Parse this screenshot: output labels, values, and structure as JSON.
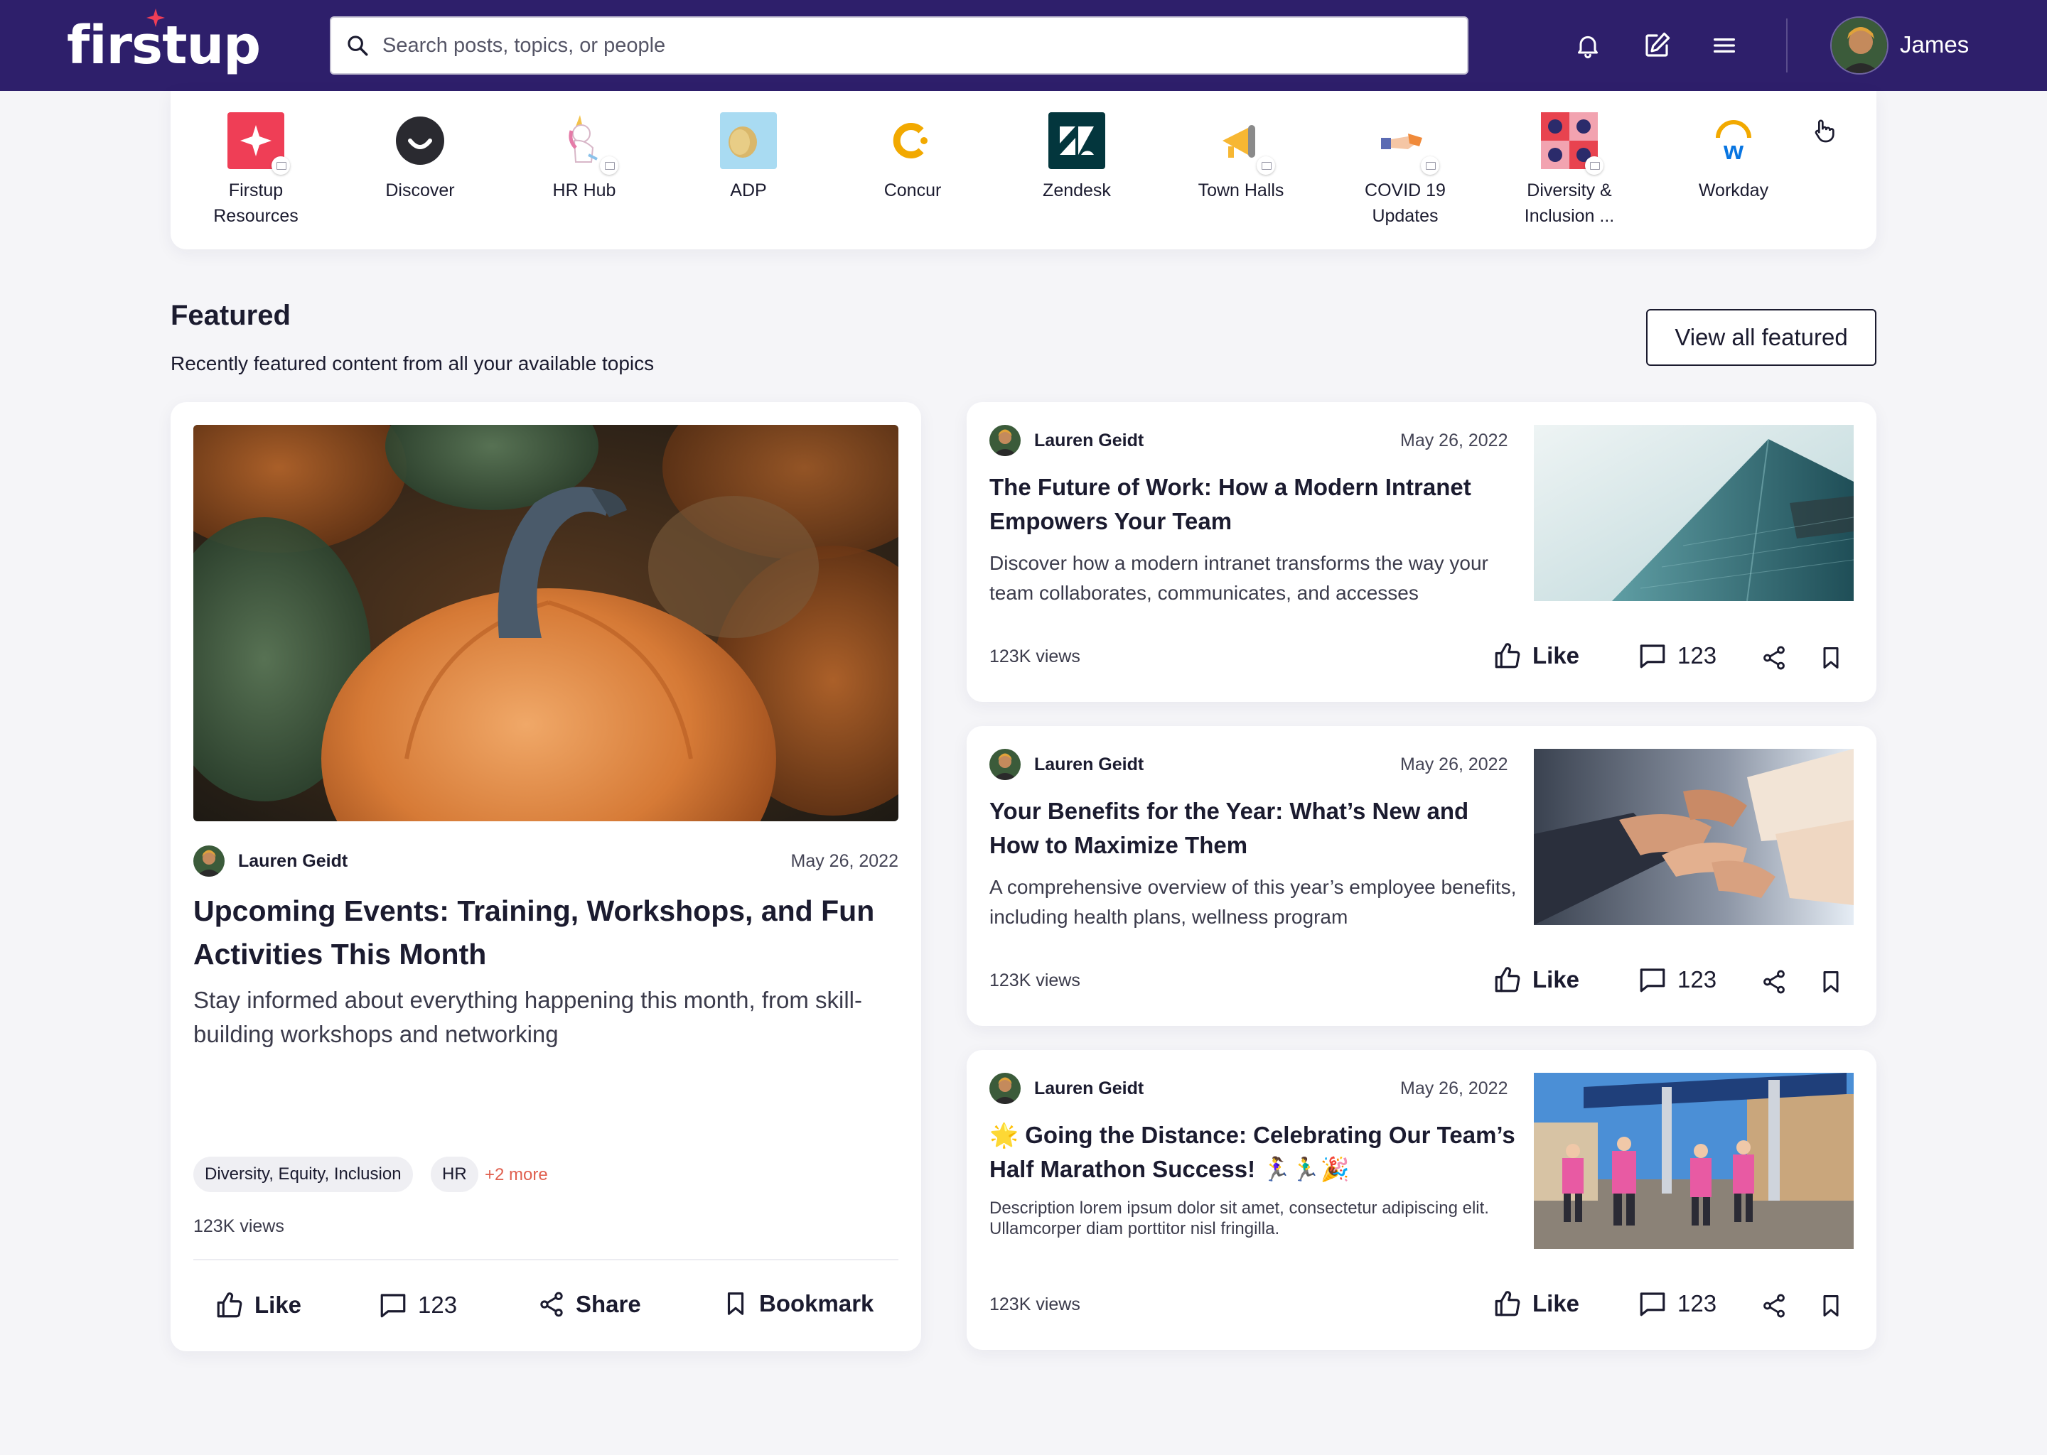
{
  "header": {
    "logo": "firstup",
    "search_placeholder": "Search posts, topics, or people",
    "user_name": "James"
  },
  "shortcuts": [
    {
      "label": "Firstup Resources",
      "icon": "firstup-star-icon"
    },
    {
      "label": "Discover",
      "icon": "smile-icon"
    },
    {
      "label": "HR Hub",
      "icon": "unicorn-icon"
    },
    {
      "label": "ADP",
      "icon": "coin-icon"
    },
    {
      "label": "Concur",
      "icon": "concur-logo-icon"
    },
    {
      "label": "Zendesk",
      "icon": "zendesk-logo-icon"
    },
    {
      "label": "Town Halls",
      "icon": "megaphone-icon"
    },
    {
      "label": "COVID 19 Updates",
      "icon": "handshake-icon"
    },
    {
      "label": "Diversity & Inclusion ...",
      "icon": "faces-icon"
    },
    {
      "label": "Workday",
      "icon": "workday-logo-icon"
    }
  ],
  "featured": {
    "title": "Featured",
    "subtitle": "Recently featured content from all your available topics",
    "view_all": "View all featured"
  },
  "main_post": {
    "author": "Lauren Geidt",
    "date": "May 26, 2022",
    "title": "Upcoming Events: Training, Workshops, and Fun Activities This Month",
    "description": "Stay informed about everything happening this month, from skill-building workshops and networking",
    "tags": [
      "Diversity, Equity, Inclusion",
      "HR"
    ],
    "more_tags": "+2 more",
    "views": "123K views",
    "actions": {
      "like": "Like",
      "comments": "123",
      "share": "Share",
      "bookmark": "Bookmark"
    }
  },
  "posts": [
    {
      "author": "Lauren Geidt",
      "date": "May 26, 2022",
      "title": " The Future of Work: How a Modern Intranet Empowers Your Team",
      "description": "Discover how a modern intranet transforms the way your team collaborates, communicates, and accesses",
      "views": "123K views",
      "like": "Like",
      "comments": "123"
    },
    {
      "author": "Lauren Geidt",
      "date": "May 26, 2022",
      "title": "Your Benefits for the Year: What’s New and How to Maximize Them",
      "description": "A comprehensive overview of this year’s employee benefits, including health plans, wellness program",
      "views": "123K views",
      "like": "Like",
      "comments": "123"
    },
    {
      "author": "Lauren Geidt",
      "date": "May 26, 2022",
      "title": "🌟 Going the Distance: Celebrating Our Team’s Half Marathon Success! 🏃‍♀️🏃‍♂️🎉",
      "description": "Description lorem ipsum dolor sit amet, consectetur adipiscing elit. Ullamcorper diam porttitor nisl fringilla.",
      "views": "123K views",
      "like": "Like",
      "comments": "123"
    }
  ],
  "colors": {
    "header_bg": "#2e1f6b",
    "accent_red": "#ef3e56",
    "tag_more": "#e0604f"
  }
}
